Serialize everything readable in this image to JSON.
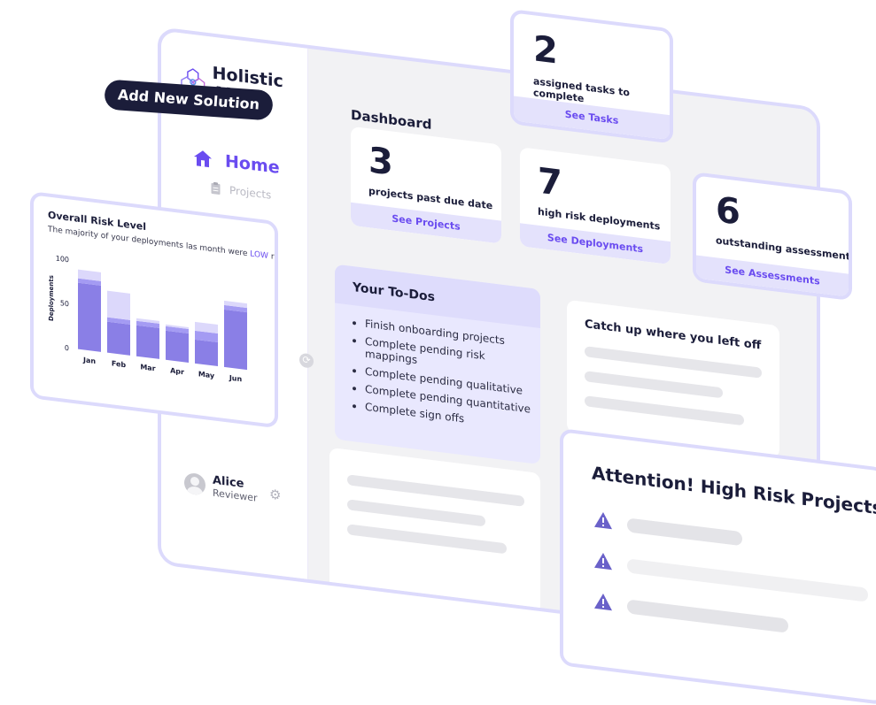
{
  "app": {
    "logo_text": "Holistic AI"
  },
  "sidebar": {
    "add_button": "Add New Solution",
    "home_label": "Home",
    "projects_label": "Projects",
    "user": {
      "name": "Alice",
      "role": "Reviewer"
    }
  },
  "dashboard": {
    "title": "Dashboard",
    "cards": [
      {
        "count": "2",
        "text": "assigned tasks to complete",
        "link": "See Tasks"
      },
      {
        "count": "3",
        "text": "projects past due date",
        "link": "See Projects"
      },
      {
        "count": "7",
        "text": "high risk deployments",
        "link": "See Deployments"
      },
      {
        "count": "6",
        "text": "outstanding assessments",
        "link": "See Assessments"
      }
    ],
    "todos": {
      "title": "Your To-Dos",
      "items": [
        "Finish onboarding projects",
        "Complete pending risk mappings",
        "Complete pending qualitative",
        "Complete pending quantitative",
        "Complete sign offs"
      ]
    },
    "catch_up_title": "Catch up where you left off",
    "attention_title": "Attention! High Risk Projects"
  },
  "risk_chart": {
    "title": "Overall Risk Level",
    "subtitle_pre": "The majority of your deployments las month were ",
    "subtitle_low": "LOW",
    "subtitle_post": " risk."
  },
  "chart_data": {
    "type": "bar",
    "title": "Overall Risk Level",
    "categories": [
      "Jan",
      "Feb",
      "Mar",
      "Apr",
      "May",
      "Jun"
    ],
    "series": [
      {
        "values": [
          75,
          35,
          35,
          33,
          27,
          65
        ]
      },
      {
        "values": [
          5,
          5,
          5,
          5,
          10,
          5
        ]
      },
      {
        "values": [
          10,
          30,
          3,
          2,
          10,
          5
        ]
      }
    ],
    "stacked": true,
    "ylabel": "Deployments",
    "yticks": [
      0,
      50,
      100
    ],
    "ylim": [
      0,
      100
    ],
    "colors": [
      "#8a7fe6",
      "#a49bf3",
      "#dcd8fb"
    ]
  },
  "colors": {
    "accent": "#6a4cf0",
    "panel_border": "#dcdafc",
    "dark": "#1b1d3a"
  }
}
